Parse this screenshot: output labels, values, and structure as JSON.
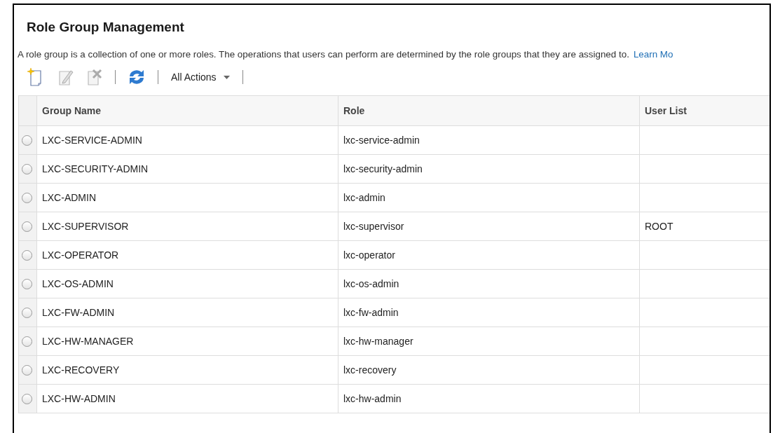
{
  "title": "Role Group Management",
  "description": "A role group is a collection of one or more roles. The operations that users can perform are determined by the role groups that they are assigned to.",
  "learn_more_link": "Learn Mo",
  "toolbar": {
    "actions_menu": "All Actions"
  },
  "table": {
    "columns": [
      "Group Name",
      "Role",
      "User List"
    ],
    "rows": [
      {
        "selected": false,
        "group_name": "LXC-SERVICE-ADMIN",
        "role": "lxc-service-admin"
      },
      {
        "selected": false,
        "group_name": "LXC-SECURITY-ADMIN",
        "role": "lxc-security-admin"
      },
      {
        "selected": false,
        "group_name": "LXC-ADMIN",
        "role": "lxc-admin"
      },
      {
        "selected": false,
        "group_name": "LXC-SUPERVISOR",
        "role": "lxc-supervisor",
        "user_list": "ROOT"
      },
      {
        "selected": false,
        "group_name": "LXC-OPERATOR",
        "role": "lxc-operator"
      },
      {
        "selected": false,
        "group_name": "LXC-OS-ADMIN",
        "role": "lxc-os-admin"
      },
      {
        "selected": false,
        "group_name": "LXC-FW-ADMIN",
        "role": "lxc-fw-admin"
      },
      {
        "selected": false,
        "group_name": "LXC-HW-MANAGER",
        "role": "lxc-hw-manager"
      },
      {
        "selected": false,
        "group_name": "LXC-RECOVERY",
        "role": "lxc-recovery"
      },
      {
        "selected": false,
        "group_name": "LXC-HW-ADMIN",
        "role": "lxc-hw-admin"
      }
    ]
  }
}
